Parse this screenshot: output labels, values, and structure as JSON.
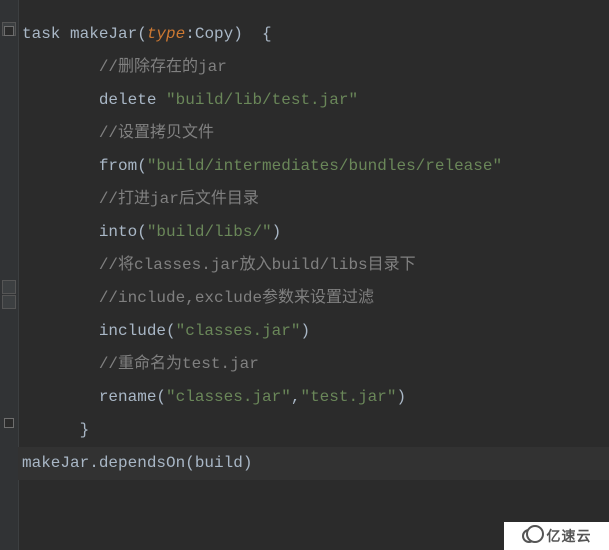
{
  "code": {
    "line1": {
      "a": "task makeJar(",
      "b": "type",
      "c": ":Copy)  {"
    },
    "line2": "//删除存在的jar",
    "line3": {
      "a": "delete ",
      "b": "\"build/lib/test.jar\""
    },
    "line4": "//设置拷贝文件",
    "line5": {
      "a": "from(",
      "b": "\"build/intermediates/bundles/release\""
    },
    "line6": "//打进jar后文件目录",
    "line7": {
      "a": "into(",
      "b": "\"build/libs/\"",
      "c": ")"
    },
    "line8": "//将classes.jar放入build/libs目录下",
    "line9": "//include,exclude参数来设置过滤",
    "line10": {
      "a": "include(",
      "b": "\"classes.jar\"",
      "c": ")"
    },
    "line11": "//重命名为test.jar",
    "line12": {
      "a": "rename(",
      "b": "\"classes.jar\"",
      "c": ",",
      "d": "\"test.jar\"",
      "e": ")"
    },
    "line13": "}",
    "line14": "makeJar.dependsOn(build)"
  },
  "indent": {
    "none": "",
    "two": "        ",
    "one": "      ",
    "brace": "         "
  },
  "watermark": "亿速云"
}
